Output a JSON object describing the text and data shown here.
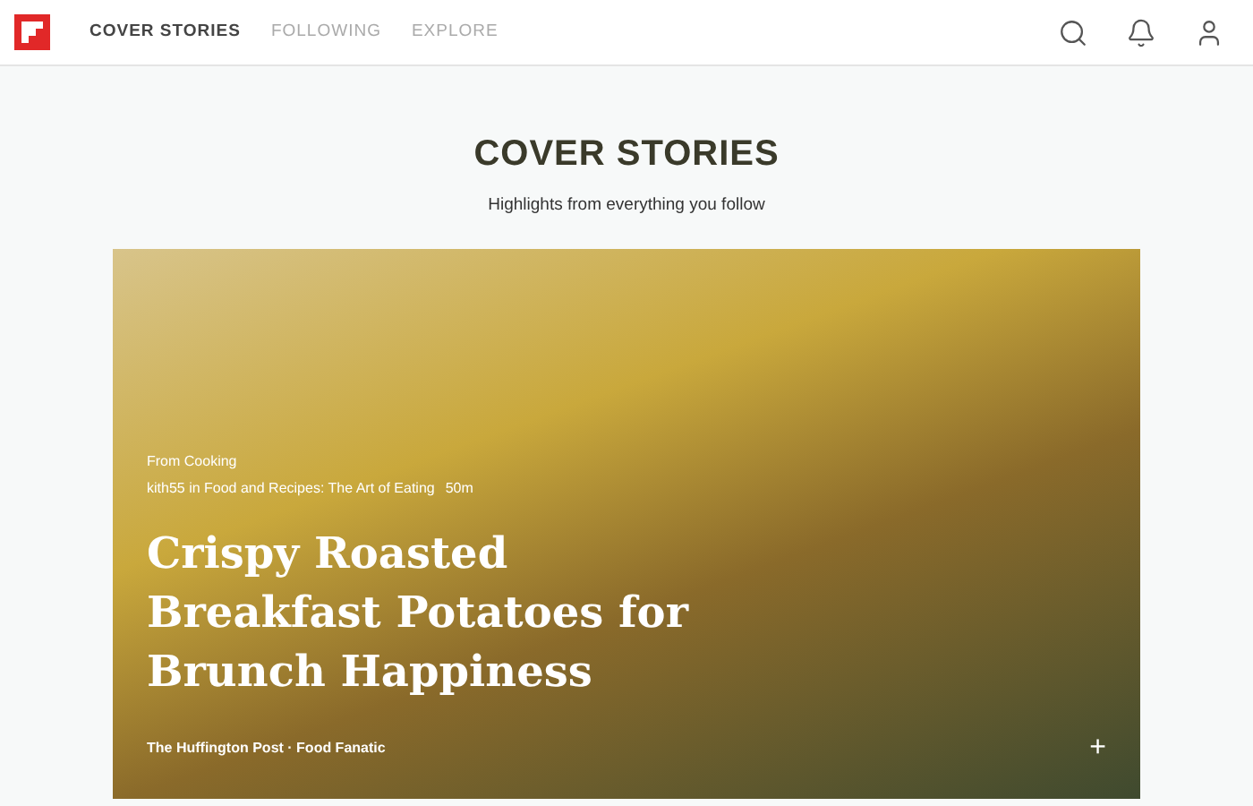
{
  "nav": {
    "tabs": [
      {
        "label": "COVER STORIES",
        "selected": true
      },
      {
        "label": "FOLLOWING",
        "selected": false
      },
      {
        "label": "EXPLORE",
        "selected": false
      }
    ]
  },
  "header": {
    "title": "COVER STORIES",
    "subtitle": "Highlights from everything you follow"
  },
  "story": {
    "section": "From Cooking",
    "curator": "kith55 in Food and Recipes: The Art of Eating",
    "age": "50m",
    "title": "Crispy Roasted Breakfast Potatoes for Brunch Happiness",
    "source": "The Huffington Post · Food Fanatic",
    "action": "+"
  }
}
